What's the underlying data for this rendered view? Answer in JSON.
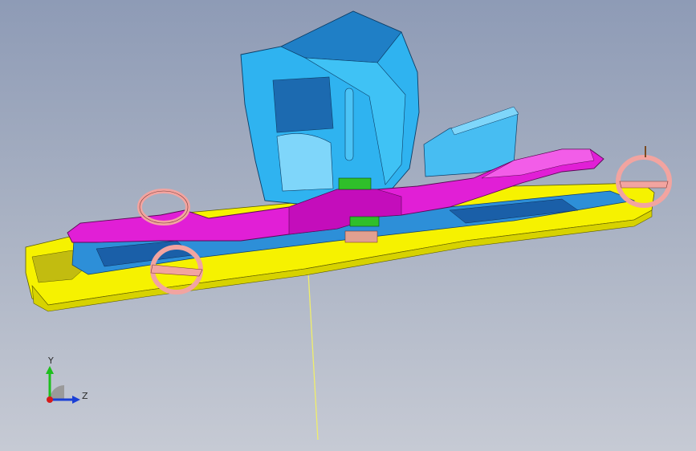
{
  "viewer": {
    "background_top": "#8e9bb6",
    "background_bottom": "#c6cad4"
  },
  "part_colors": {
    "base_plate": "#f6f200",
    "lifter_bar": "#e11fd6",
    "upper_bracket": "#2fb3f0",
    "bracket_shadow": "#1f7fc6",
    "insert_green": "#2fbf2a",
    "lift_eye": "#f2a4a0",
    "axis_line": "#f0ee6a"
  },
  "icons": {
    "triad": "coordinate-axes-icon",
    "lift_ring": "lifting-eye-icon"
  },
  "triad": {
    "y_label": "Y",
    "z_label": "Z",
    "y_color": "#1dbf1d",
    "z_color": "#1a3fd6",
    "x_color": "#d61a1a"
  }
}
